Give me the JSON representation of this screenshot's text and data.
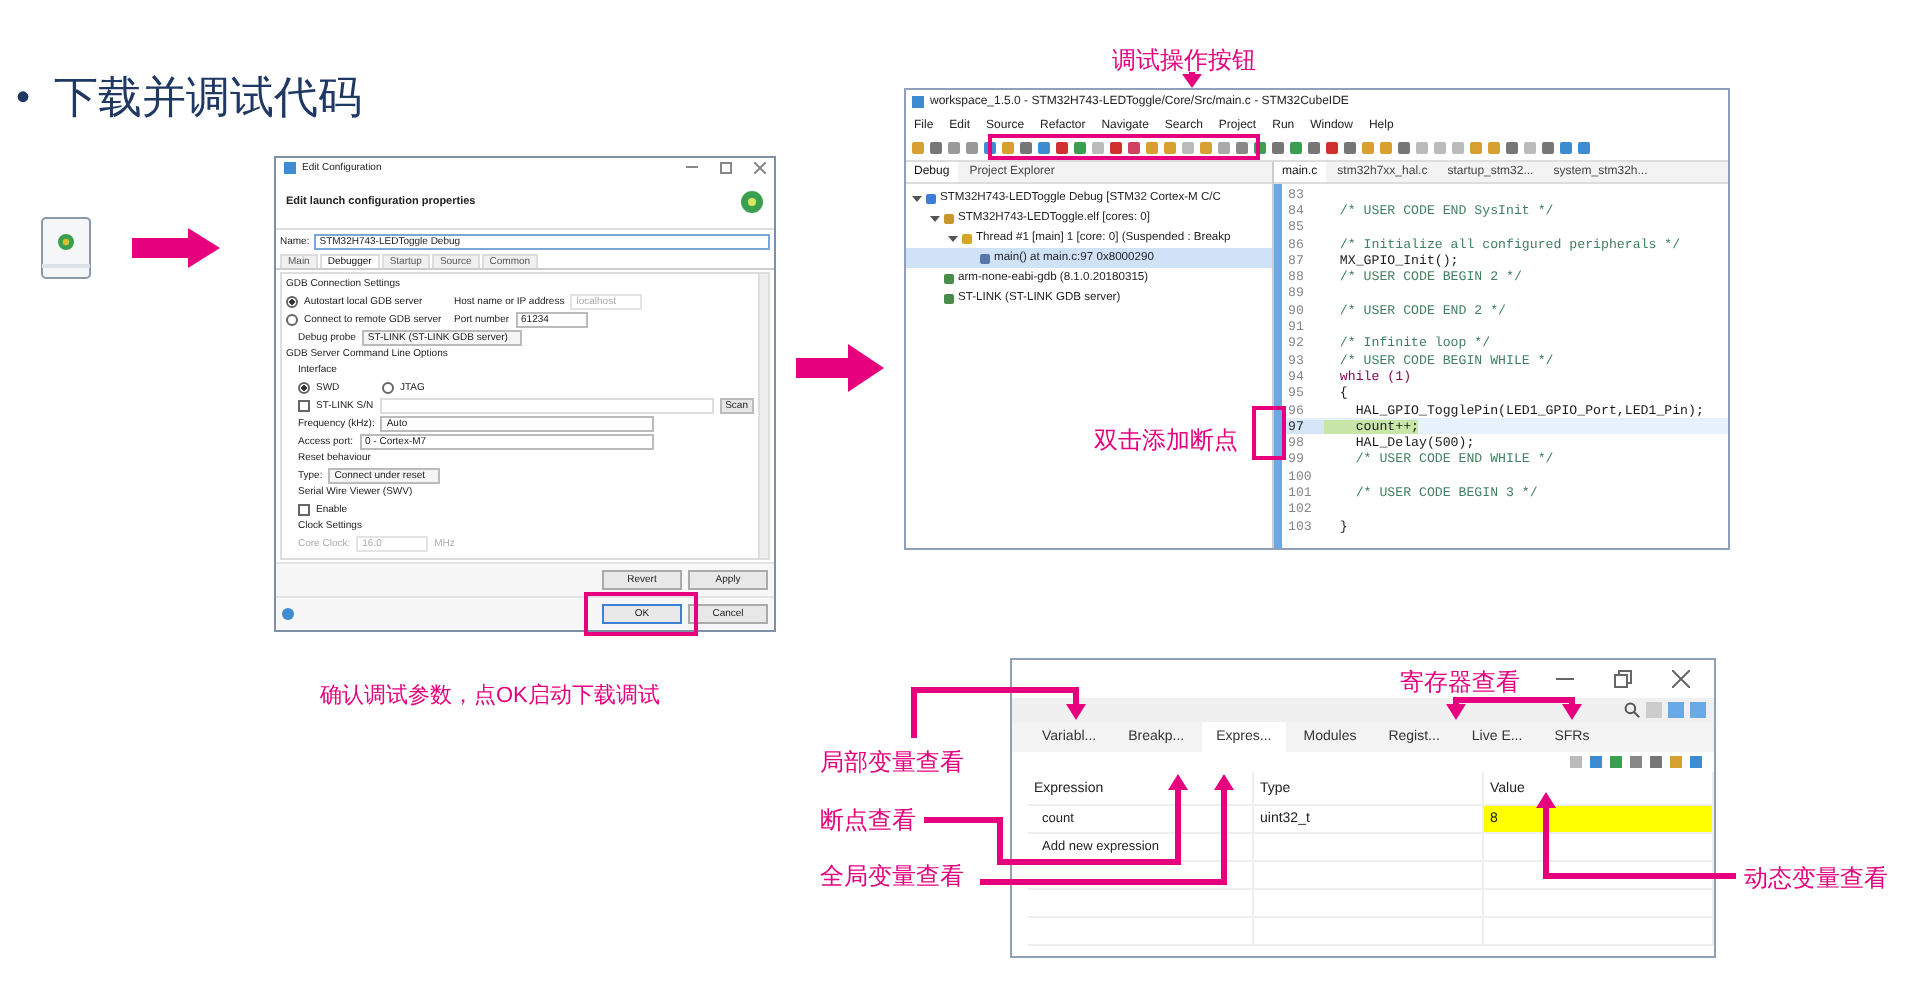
{
  "slide_title": {
    "bullet": "•",
    "text": "下载并调试代码"
  },
  "config_dialog": {
    "title": "Edit Configuration",
    "heading": "Edit launch configuration properties",
    "name_label": "Name:",
    "name_value": "STM32H743-LEDToggle Debug",
    "tabs": [
      {
        "label": "Main",
        "selected": false
      },
      {
        "label": "Debugger",
        "selected": true
      },
      {
        "label": "Startup",
        "selected": false
      },
      {
        "label": "Source",
        "selected": false
      },
      {
        "label": "Common",
        "selected": false
      }
    ],
    "rows": [
      {
        "kind": "section",
        "label": "GDB Connection Settings"
      },
      {
        "kind": "radio",
        "label": "Autostart local GDB server",
        "checked": true,
        "field_label": "Host name or IP address",
        "field_value": "localhost",
        "field_disabled": true
      },
      {
        "kind": "radio",
        "label": "Connect to remote GDB server",
        "checked": false,
        "field_label": "Port number",
        "field_value": "61234",
        "field_disabled": false
      },
      {
        "kind": "select",
        "label": "Debug probe",
        "value": "ST-LINK (ST-LINK GDB server)"
      },
      {
        "kind": "section",
        "label": "GDB Server Command Line Options"
      },
      {
        "kind": "subsection",
        "label": "Interface"
      },
      {
        "kind": "radio_pair",
        "options": [
          {
            "label": "SWD",
            "selected": true
          },
          {
            "label": "JTAG",
            "selected": false
          }
        ]
      },
      {
        "kind": "checkbox",
        "label": "ST-LINK S/N",
        "checked": false,
        "button": "Scan"
      },
      {
        "kind": "wide_select",
        "label": "Frequency (kHz):",
        "value": "Auto"
      },
      {
        "kind": "wide_select",
        "label": "Access port:",
        "value": "0 - Cortex-M7"
      },
      {
        "kind": "subsection",
        "label": "Reset behaviour"
      },
      {
        "kind": "select",
        "label": "Type:",
        "value": "Connect under reset"
      },
      {
        "kind": "subsection",
        "label": "Serial Wire Viewer (SWV)"
      },
      {
        "kind": "checkbox",
        "label": "Enable",
        "checked": false
      },
      {
        "kind": "subsection",
        "label": "Clock Settings"
      },
      {
        "kind": "field",
        "label": "Core Clock:",
        "value": "16.0",
        "unit": "MHz",
        "disabled": true
      }
    ],
    "edit_buttons": [
      "Revert",
      "Apply"
    ],
    "dialog_buttons": [
      {
        "label": "OK",
        "default": true
      },
      {
        "label": "Cancel",
        "default": false
      }
    ]
  },
  "caption": "确认调试参数，点OK启动下载调试",
  "ide": {
    "title": "workspace_1.5.0 - STM32H743-LEDToggle/Core/Src/main.c - STM32CubeIDE",
    "menu": [
      "File",
      "Edit",
      "Source",
      "Refactor",
      "Navigate",
      "Search",
      "Project",
      "Run",
      "Window",
      "Help"
    ],
    "left_tabs": [
      {
        "label": "Debug",
        "selected": true
      },
      {
        "label": "Project Explorer",
        "selected": false
      }
    ],
    "tree": [
      {
        "label": "STM32H743-LEDToggle Debug [STM32 Cortex-M C/C",
        "kind": "launch",
        "expanded": true,
        "selected": false,
        "children": [
          {
            "label": "STM32H743-LEDToggle.elf [cores: 0]",
            "kind": "binary",
            "expanded": true,
            "selected": false,
            "children": [
              {
                "label": "Thread #1 [main] 1 [core: 0] (Suspended : Breakp",
                "kind": "thread",
                "expanded": true,
                "selected": false,
                "children": [
                  {
                    "label": "main() at main.c:97 0x8000290",
                    "kind": "frame",
                    "selected": true
                  }
                ]
              }
            ]
          },
          {
            "label": "arm-none-eabi-gdb (8.1.0.20180315)",
            "kind": "process",
            "selected": false
          },
          {
            "label": "ST-LINK (ST-LINK GDB server)",
            "kind": "process",
            "selected": false
          }
        ]
      }
    ],
    "editor_tabs": [
      {
        "label": "main.c",
        "selected": true
      },
      {
        "label": "stm32h7xx_hal.c",
        "selected": false
      },
      {
        "label": "startup_stm32...",
        "selected": false
      },
      {
        "label": "system_stm32h...",
        "selected": false
      }
    ],
    "code": [
      {
        "number": "83",
        "kind": "blank",
        "highlighted": false
      },
      {
        "number": "84",
        "code": "  /* USER CODE END SysInit */",
        "kind": "comment",
        "highlighted": false
      },
      {
        "number": "85",
        "kind": "blank",
        "highlighted": false
      },
      {
        "number": "86",
        "code": "  /* Initialize all configured peripherals */",
        "kind": "comment",
        "highlighted": false
      },
      {
        "number": "87",
        "code": "  MX_GPIO_Init();",
        "kind": "code",
        "highlighted": false
      },
      {
        "number": "88",
        "code": "  /* USER CODE BEGIN 2 */",
        "kind": "comment",
        "highlighted": false
      },
      {
        "number": "89",
        "kind": "blank",
        "highlighted": false
      },
      {
        "number": "90",
        "code": "  /* USER CODE END 2 */",
        "kind": "comment",
        "highlighted": false
      },
      {
        "number": "91",
        "kind": "blank",
        "highlighted": false
      },
      {
        "number": "92",
        "code": "  /* Infinite loop */",
        "kind": "comment",
        "highlighted": false
      },
      {
        "number": "93",
        "code": "  /* USER CODE BEGIN WHILE */",
        "kind": "comment",
        "highlighted": false
      },
      {
        "number": "94",
        "code": "  while (1)",
        "kind": "keyword",
        "highlighted": false
      },
      {
        "number": "95",
        "code": "  {",
        "kind": "code",
        "highlighted": false
      },
      {
        "number": "96",
        "code": "    HAL_GPIO_TogglePin(LED1_GPIO_Port,LED1_Pin);",
        "kind": "code",
        "highlighted": false
      },
      {
        "number": "97",
        "code": "    count++;",
        "kind": "code",
        "highlighted": true
      },
      {
        "number": "98",
        "code": "    HAL_Delay(500);",
        "kind": "code",
        "highlighted": false
      },
      {
        "number": "99",
        "code": "    /* USER CODE END WHILE */",
        "kind": "comment",
        "highlighted": false
      },
      {
        "number": "100",
        "kind": "blank",
        "highlighted": false
      },
      {
        "number": "101",
        "code": "    /* USER CODE BEGIN 3 */",
        "kind": "comment",
        "highlighted": false
      },
      {
        "number": "102",
        "kind": "blank",
        "highlighted": false
      },
      {
        "number": "103",
        "code": "  }",
        "kind": "code",
        "highlighted": false
      }
    ]
  },
  "variables_panel": {
    "tabs": [
      {
        "label": "Variabl...",
        "selected": false
      },
      {
        "label": "Breakp...",
        "selected": false
      },
      {
        "label": "Expres...",
        "selected": true
      },
      {
        "label": "Modules",
        "selected": false
      },
      {
        "label": "Regist...",
        "selected": false
      },
      {
        "label": "Live E...",
        "selected": false
      },
      {
        "label": "SFRs",
        "selected": false
      }
    ],
    "columns": [
      "Expression",
      "Type",
      "Value"
    ],
    "rows": [
      {
        "name": "count",
        "type": "uint32_t",
        "value": "8",
        "changed": true
      }
    ],
    "add_row": "Add new expression"
  },
  "annotations": [
    {
      "kind": "toolbar",
      "text": "调试操作按钮"
    },
    {
      "kind": "gutter",
      "text": "双击添加断点"
    },
    {
      "kind": "locals",
      "text": "局部变量查看"
    },
    {
      "kind": "breakpoints",
      "text": "断点查看"
    },
    {
      "kind": "globals",
      "text": "全局变量查看"
    },
    {
      "kind": "registers",
      "text": "寄存器查看"
    },
    {
      "kind": "live",
      "text": "动态变量查看"
    }
  ]
}
